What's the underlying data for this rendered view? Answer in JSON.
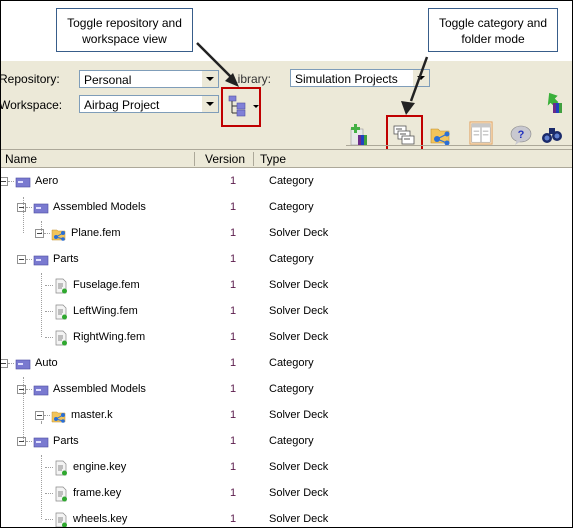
{
  "callouts": {
    "left": "Toggle repository and workspace view",
    "right": "Toggle category and folder mode"
  },
  "form": {
    "repository_label": "Repository:",
    "repository_value": "Personal",
    "workspace_label": "Workspace:",
    "workspace_value": "Airbag Project",
    "library_label": "Library:",
    "library_value": "Simulation Projects"
  },
  "toolbar": {
    "icons": [
      "tree-view-toggle-icon",
      "import-library-icon",
      "add-library-icon",
      "category-folder-toggle-icon",
      "folder-network-icon",
      "layout-panel-icon",
      "help-icon",
      "binoculars-search-icon"
    ]
  },
  "columns": {
    "name": "Name",
    "version": "Version",
    "type": "Type"
  },
  "colors": {
    "highlight": "#c00000",
    "version_text": "#5a1a4a",
    "panel_bg": "#ece9d8",
    "callout_border": "#385d8a"
  },
  "tree": [
    {
      "name": "Aero",
      "version": "1",
      "type": "Category",
      "level": 0,
      "icon": "category-icon"
    },
    {
      "name": "Assembled Models",
      "version": "1",
      "type": "Category",
      "level": 1,
      "icon": "category-icon"
    },
    {
      "name": "Plane.fem",
      "version": "1",
      "type": "Solver Deck",
      "level": 2,
      "icon": "assembly-icon"
    },
    {
      "name": "Parts",
      "version": "1",
      "type": "Category",
      "level": 1,
      "icon": "category-icon"
    },
    {
      "name": "Fuselage.fem",
      "version": "1",
      "type": "Solver Deck",
      "level": 2,
      "icon": "document-icon"
    },
    {
      "name": "LeftWing.fem",
      "version": "1",
      "type": "Solver Deck",
      "level": 2,
      "icon": "document-icon"
    },
    {
      "name": "RightWing.fem",
      "version": "1",
      "type": "Solver Deck",
      "level": 2,
      "icon": "document-icon"
    },
    {
      "name": "Auto",
      "version": "1",
      "type": "Category",
      "level": 0,
      "icon": "category-icon"
    },
    {
      "name": "Assembled Models",
      "version": "1",
      "type": "Category",
      "level": 1,
      "icon": "category-icon"
    },
    {
      "name": "master.k",
      "version": "1",
      "type": "Solver Deck",
      "level": 2,
      "icon": "assembly-icon"
    },
    {
      "name": "Parts",
      "version": "1",
      "type": "Category",
      "level": 1,
      "icon": "category-icon"
    },
    {
      "name": "engine.key",
      "version": "1",
      "type": "Solver Deck",
      "level": 2,
      "icon": "document-icon"
    },
    {
      "name": "frame.key",
      "version": "1",
      "type": "Solver Deck",
      "level": 2,
      "icon": "document-icon"
    },
    {
      "name": "wheels.key",
      "version": "1",
      "type": "Solver Deck",
      "level": 2,
      "icon": "document-icon"
    }
  ]
}
